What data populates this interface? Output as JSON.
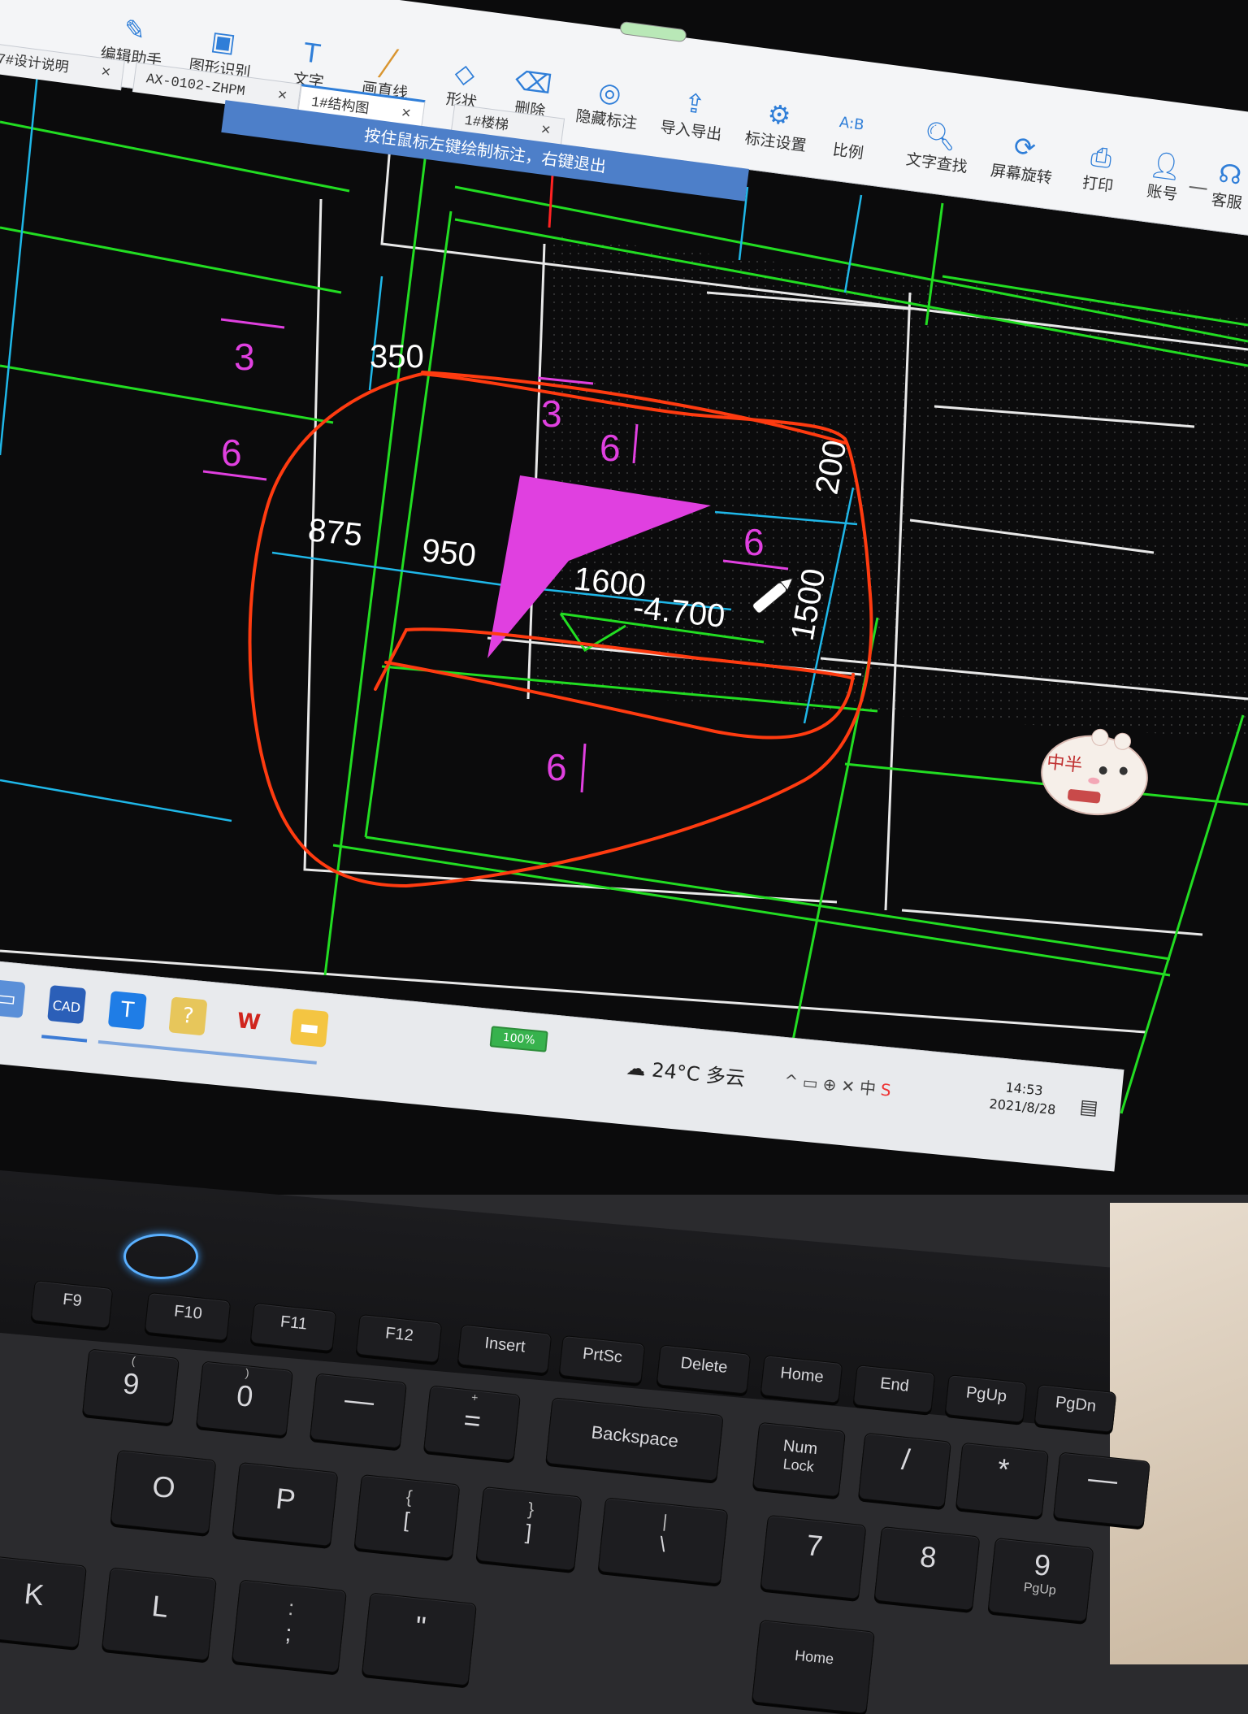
{
  "ribbon": {
    "tools": [
      {
        "label": "编辑助手",
        "icon": "edit-assistant-icon"
      },
      {
        "label": "图形识别",
        "icon": "shape-recognize-icon"
      },
      {
        "label": "文字",
        "icon": "text-icon"
      },
      {
        "label": "画直线",
        "icon": "line-icon"
      },
      {
        "label": "形状",
        "icon": "shape-icon"
      },
      {
        "label": "删除",
        "icon": "eraser-icon"
      },
      {
        "label": "隐藏标注",
        "icon": "hide-annotation-icon"
      },
      {
        "label": "导入导出",
        "icon": "import-export-icon"
      },
      {
        "label": "标注设置",
        "icon": "annotation-settings-icon"
      },
      {
        "label": "比例",
        "icon": "scale-icon"
      },
      {
        "label": "文字查找",
        "icon": "text-search-icon"
      },
      {
        "label": "屏幕旋转",
        "icon": "screen-rotate-icon"
      },
      {
        "label": "打印",
        "icon": "print-icon"
      },
      {
        "label": "账号",
        "icon": "account-icon"
      },
      {
        "label": "客服",
        "icon": "support-icon"
      }
    ],
    "scale_badge": "A:B"
  },
  "tabs": [
    {
      "label": "7#设计说明",
      "active": false
    },
    {
      "label": "AX-0102-ZHPM",
      "active": false
    },
    {
      "label": "1#结构图",
      "active": true
    },
    {
      "label": "1#楼梯",
      "active": false
    }
  ],
  "hint": "按住鼠标左键绘制标注，右键退出",
  "drawing": {
    "dims": {
      "d350": "350",
      "d875": "875",
      "d950": "950",
      "d1600": "1600",
      "d200": "200",
      "d1500": "1500",
      "elev": "-4.700"
    },
    "marks": {
      "m3a": "3",
      "m3b": "3",
      "m6a": "6",
      "m6b": "6",
      "m6c": "6",
      "m6d": "6"
    },
    "colors": {
      "background": "#0b0b0c",
      "green": "#22dd22",
      "cyan": "#1fb7e8",
      "white": "#e8e8e8",
      "magenta": "#e040e0",
      "red_annotation": "#ff3b10"
    }
  },
  "taskbar": {
    "battery": "100%",
    "weather": "24°C 多云",
    "time": "14:53",
    "date": "2021/8/28",
    "tray_badge": "中"
  },
  "sticker": {
    "text": "中半"
  },
  "keyboard": {
    "row_f": [
      "F9",
      "F10",
      "F11",
      "F12",
      "Insert",
      "PrtSc",
      "Delete",
      "Home",
      "End",
      "PgUp",
      "PgDn"
    ],
    "row_num": [
      [
        "(",
        "9"
      ],
      [
        ")",
        "0"
      ],
      [
        "",
        "—"
      ],
      [
        "+",
        "="
      ],
      [
        "Backspace",
        ""
      ],
      [
        "Num",
        "Lock"
      ],
      [
        "",
        "/"
      ],
      [
        "",
        "*"
      ],
      [
        "",
        "—"
      ]
    ],
    "row_top": [
      [
        "O",
        ""
      ],
      [
        "P",
        ""
      ],
      [
        "{",
        "["
      ],
      [
        "}",
        "]"
      ],
      [
        "|",
        "\\"
      ],
      [
        "7",
        ""
      ],
      [
        "8",
        ""
      ],
      [
        "9",
        "PgUp"
      ]
    ],
    "row_home": [
      [
        "K",
        ""
      ],
      [
        "L",
        ""
      ],
      [
        ":",
        ";"
      ],
      [
        "\"",
        ""
      ],
      [
        "",
        ""
      ],
      [
        "Home",
        ""
      ],
      [
        "",
        ""
      ]
    ]
  }
}
